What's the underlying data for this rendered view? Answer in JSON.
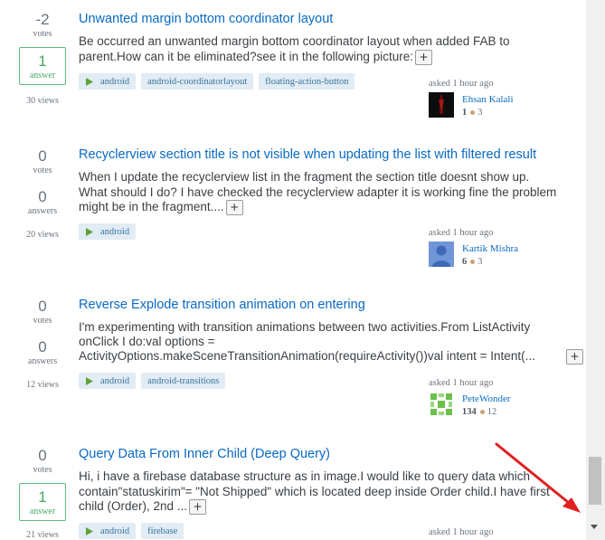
{
  "colors": {
    "link": "#0a6ac2",
    "tag_bg": "#e1ecf4",
    "tag_text": "#39739d",
    "answered": "#48a868",
    "annotation_arrow": "#e02020"
  },
  "icons": {
    "tag_icon": "android-icon",
    "expand": "plus-icon",
    "reputation_badge": "bronze-badge-icon",
    "scroll": "chevron-down-icon",
    "annotation": "red-arrow-icon"
  },
  "questions": [
    {
      "votes": "-2",
      "votes_label": "votes",
      "answers": "1",
      "answers_label": "answer",
      "views": "30 views",
      "title": "Unwanted margin bottom coordinator layout",
      "excerpt": "Be occurred an unwanted margin bottom coordinator layout when added FAB to parent.How can it be eliminated?see it in the following picture:",
      "more": "+",
      "tags": [
        "android",
        "android-coordinatorlayout",
        "floating-action-button"
      ],
      "asked": "asked 1 hour ago",
      "user": "Ehsan Kalali",
      "rep": "1",
      "bronze": "3"
    },
    {
      "votes": "0",
      "votes_label": "votes",
      "answers": "0",
      "answers_label": "answers",
      "views": "20 views",
      "title": "Recyclerview section title is not visible when updating the list with filtered result",
      "excerpt": "When I update the recyclerview list in the fragment the section title doesnt show up. What should I do? I have checked the recyclerview adapter it is working fine the problem might be in the fragment....",
      "more": "+",
      "tags": [
        "android"
      ],
      "asked": "asked 1 hour ago",
      "user": "Kartik Mishra",
      "rep": "6",
      "bronze": "3"
    },
    {
      "votes": "0",
      "votes_label": "votes",
      "answers": "0",
      "answers_label": "answers",
      "views": "12 views",
      "title": "Reverse Explode transition animation on entering",
      "excerpt_lines": [
        "I'm experimenting with transition animations between two activities.From ListActivity",
        "onClick I do:val options =",
        "ActivityOptions.makeSceneTransitionAnimation(requireActivity())val intent = Intent(..."
      ],
      "more": "+",
      "tags": [
        "android",
        "android-transitions"
      ],
      "asked": "asked 1 hour ago",
      "user": "PeteWonder",
      "rep": "134",
      "bronze": "12"
    },
    {
      "votes": "0",
      "votes_label": "votes",
      "answers": "1",
      "answers_label": "answer",
      "views": "21 views",
      "title": "Query Data From Inner Child (Deep Query)",
      "excerpt": "Hi, i have a firebase database structure as in image.I would like to query data which contain\"statuskirim\"= \"Not Shipped\" which is located deep inside Order child.I have first child (Order), 2nd ...",
      "more": "+",
      "tags": [
        "android",
        "firebase"
      ],
      "asked": "asked 1 hour ago"
    }
  ]
}
